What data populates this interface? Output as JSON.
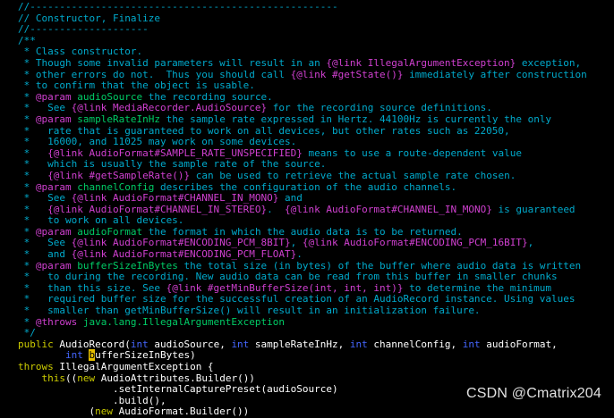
{
  "colors": {
    "comment": "#00aacc",
    "doctag": "#d040d0",
    "param": "#00cc66",
    "keyword": "#cccc00",
    "type": "#4466ff",
    "text": "#ffffff",
    "cursor": "#e6c000"
  },
  "editor": {
    "lines": [
      [
        {
          "t": "//----------------------------------------------------",
          "c": "comment"
        }
      ],
      [
        {
          "t": "// Constructor, Finalize",
          "c": "comment"
        }
      ],
      [
        {
          "t": "//--------------------",
          "c": "comment"
        }
      ],
      [
        {
          "t": "/**",
          "c": "comment"
        }
      ],
      [
        {
          "t": " * Class constructor.",
          "c": "comment"
        }
      ],
      [
        {
          "t": " * Though some invalid parameters will result in an ",
          "c": "comment"
        },
        {
          "t": "{@link IllegalArgumentException}",
          "c": "doctag"
        },
        {
          "t": " exception,",
          "c": "comment"
        }
      ],
      [
        {
          "t": " * other errors do not.  Thus you should call ",
          "c": "comment"
        },
        {
          "t": "{@link #getState()}",
          "c": "doctag"
        },
        {
          "t": " immediately after construction",
          "c": "comment"
        }
      ],
      [
        {
          "t": " * to confirm that the object is usable.",
          "c": "comment"
        }
      ],
      [
        {
          "t": " * ",
          "c": "comment"
        },
        {
          "t": "@param",
          "c": "doctag"
        },
        {
          "t": " audioSource",
          "c": "param"
        },
        {
          "t": " the recording source.",
          "c": "comment"
        }
      ],
      [
        {
          "t": " *   See ",
          "c": "comment"
        },
        {
          "t": "{@link MediaRecorder.AudioSource}",
          "c": "doctag"
        },
        {
          "t": " for the recording source definitions.",
          "c": "comment"
        }
      ],
      [
        {
          "t": " * ",
          "c": "comment"
        },
        {
          "t": "@param",
          "c": "doctag"
        },
        {
          "t": " sampleRateInHz",
          "c": "param"
        },
        {
          "t": " the sample rate expressed in Hertz. 44100Hz is currently the only",
          "c": "comment"
        }
      ],
      [
        {
          "t": " *   rate that is guaranteed to work on all devices, but other rates such as 22050,",
          "c": "comment"
        }
      ],
      [
        {
          "t": " *   16000, and 11025 may work on some devices.",
          "c": "comment"
        }
      ],
      [
        {
          "t": " *   ",
          "c": "comment"
        },
        {
          "t": "{@link AudioFormat#SAMPLE_RATE_UNSPECIFIED}",
          "c": "doctag"
        },
        {
          "t": " means to use a route-dependent value",
          "c": "comment"
        }
      ],
      [
        {
          "t": " *   which is usually the sample rate of the source.",
          "c": "comment"
        }
      ],
      [
        {
          "t": " *   ",
          "c": "comment"
        },
        {
          "t": "{@link #getSampleRate()}",
          "c": "doctag"
        },
        {
          "t": " can be used to retrieve the actual sample rate chosen.",
          "c": "comment"
        }
      ],
      [
        {
          "t": " * ",
          "c": "comment"
        },
        {
          "t": "@param",
          "c": "doctag"
        },
        {
          "t": " channelConfig",
          "c": "param"
        },
        {
          "t": " describes the configuration of the audio channels.",
          "c": "comment"
        }
      ],
      [
        {
          "t": " *   See ",
          "c": "comment"
        },
        {
          "t": "{@link AudioFormat#CHANNEL_IN_MONO}",
          "c": "doctag"
        },
        {
          "t": " and",
          "c": "comment"
        }
      ],
      [
        {
          "t": " *   ",
          "c": "comment"
        },
        {
          "t": "{@link AudioFormat#CHANNEL_IN_STEREO}",
          "c": "doctag"
        },
        {
          "t": ".  ",
          "c": "comment"
        },
        {
          "t": "{@link AudioFormat#CHANNEL_IN_MONO}",
          "c": "doctag"
        },
        {
          "t": " is guaranteed",
          "c": "comment"
        }
      ],
      [
        {
          "t": " *   to work on all devices.",
          "c": "comment"
        }
      ],
      [
        {
          "t": " * ",
          "c": "comment"
        },
        {
          "t": "@param",
          "c": "doctag"
        },
        {
          "t": " audioFormat",
          "c": "param"
        },
        {
          "t": " the format in which the audio data is to be returned.",
          "c": "comment"
        }
      ],
      [
        {
          "t": " *   See ",
          "c": "comment"
        },
        {
          "t": "{@link AudioFormat#ENCODING_PCM_8BIT}",
          "c": "doctag"
        },
        {
          "t": ", ",
          "c": "comment"
        },
        {
          "t": "{@link AudioFormat#ENCODING_PCM_16BIT}",
          "c": "doctag"
        },
        {
          "t": ",",
          "c": "comment"
        }
      ],
      [
        {
          "t": " *   and ",
          "c": "comment"
        },
        {
          "t": "{@link AudioFormat#ENCODING_PCM_FLOAT}",
          "c": "doctag"
        },
        {
          "t": ".",
          "c": "comment"
        }
      ],
      [
        {
          "t": " * ",
          "c": "comment"
        },
        {
          "t": "@param",
          "c": "doctag"
        },
        {
          "t": " bufferSizeInBytes",
          "c": "param"
        },
        {
          "t": " the total size (in bytes) of the buffer where audio data is written",
          "c": "comment"
        }
      ],
      [
        {
          "t": " *   to during the recording. New audio data can be read from this buffer in smaller chunks",
          "c": "comment"
        }
      ],
      [
        {
          "t": " *   than this size. See ",
          "c": "comment"
        },
        {
          "t": "{@link #getMinBufferSize(int, int, int)}",
          "c": "doctag"
        },
        {
          "t": " to determine the minimum",
          "c": "comment"
        }
      ],
      [
        {
          "t": " *   required buffer size for the successful creation of an AudioRecord instance. Using values",
          "c": "comment"
        }
      ],
      [
        {
          "t": " *   smaller than getMinBufferSize() will result in an initialization failure.",
          "c": "comment"
        }
      ],
      [
        {
          "t": " * ",
          "c": "comment"
        },
        {
          "t": "@throws",
          "c": "doctag"
        },
        {
          "t": " java.lang.IllegalArgumentException",
          "c": "param"
        }
      ],
      [
        {
          "t": " */",
          "c": "comment"
        }
      ],
      [
        {
          "t": "public",
          "c": "keyword"
        },
        {
          "t": " AudioRecord(",
          "c": "text"
        },
        {
          "t": "int",
          "c": "type"
        },
        {
          "t": " audioSource, ",
          "c": "text"
        },
        {
          "t": "int",
          "c": "type"
        },
        {
          "t": " sampleRateInHz, ",
          "c": "text"
        },
        {
          "t": "int",
          "c": "type"
        },
        {
          "t": " channelConfig, ",
          "c": "text"
        },
        {
          "t": "int",
          "c": "type"
        },
        {
          "t": " audioFormat,",
          "c": "text"
        }
      ],
      [
        {
          "t": "        ",
          "c": "text"
        },
        {
          "t": "int",
          "c": "type"
        },
        {
          "t": " ",
          "c": "text"
        },
        {
          "t": "b",
          "c": "cursor"
        },
        {
          "t": "ufferSizeInBytes)",
          "c": "text"
        }
      ],
      [
        {
          "t": "throws",
          "c": "keyword"
        },
        {
          "t": " IllegalArgumentException {",
          "c": "text"
        }
      ],
      [
        {
          "t": "    ",
          "c": "text"
        },
        {
          "t": "this",
          "c": "keyword"
        },
        {
          "t": "((",
          "c": "text"
        },
        {
          "t": "new",
          "c": "keyword"
        },
        {
          "t": " AudioAttributes.Builder())",
          "c": "text"
        }
      ],
      [
        {
          "t": "                .setInternalCapturePreset(audioSource)",
          "c": "text"
        }
      ],
      [
        {
          "t": "                .build(),",
          "c": "text"
        }
      ],
      [
        {
          "t": "            (",
          "c": "text"
        },
        {
          "t": "new",
          "c": "keyword"
        },
        {
          "t": " AudioFormat.Builder())",
          "c": "text"
        }
      ]
    ]
  },
  "watermark": "CSDN @Cmatrix204"
}
